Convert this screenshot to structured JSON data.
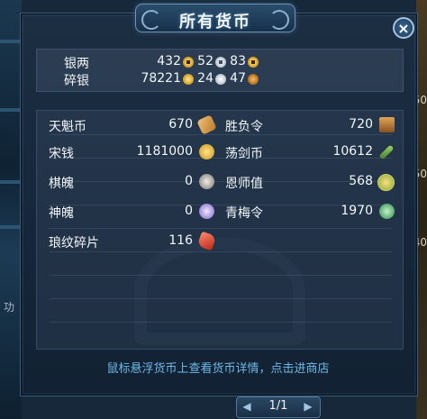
{
  "window": {
    "title": "所有货币",
    "close_label": "×"
  },
  "background": {
    "left_text": "功",
    "right_numbers": [
      "50",
      "50",
      "40"
    ]
  },
  "silver": {
    "ghost_text": "",
    "rows": [
      {
        "label": "银两",
        "amount": "432",
        "silver": "52",
        "copper": "83",
        "kind": "tael"
      },
      {
        "label": "碎银",
        "amount": "78221",
        "silver": "24",
        "copper": "47",
        "kind": "coin"
      }
    ]
  },
  "currencies": {
    "left": [
      {
        "label": "天魁币",
        "value": "670",
        "icon": "scroll-icon",
        "color": "#d8a35a"
      },
      {
        "label": "宋钱",
        "value": "1181000",
        "icon": "gold-coin-icon",
        "color": "#e0b43a"
      },
      {
        "label": "棋魄",
        "value": "0",
        "icon": "chess-piece-icon",
        "color": "#c9c6c2"
      },
      {
        "label": "神魄",
        "value": "0",
        "icon": "purple-orb-icon",
        "color": "#b7a6e8"
      },
      {
        "label": "琅纹碎片",
        "value": "116",
        "icon": "red-fragment-icon",
        "color": "#d84a3a"
      }
    ],
    "right": [
      {
        "label": "胜负令",
        "value": "720",
        "icon": "token-tablet-icon",
        "color": "#c98a3a"
      },
      {
        "label": "荡剑币",
        "value": "10612",
        "icon": "sword-icon",
        "color": "#6ea04a"
      },
      {
        "label": "恩师值",
        "value": "568",
        "icon": "gold-medal-icon",
        "color": "#d8b24a"
      },
      {
        "label": "青梅令",
        "value": "1970",
        "icon": "green-plum-icon",
        "color": "#3aa86a"
      }
    ]
  },
  "hint_text": "鼠标悬浮货币上查看货币详情，点击进商店",
  "pager": {
    "text": "1/1",
    "prev": "◀",
    "next": "▶"
  }
}
